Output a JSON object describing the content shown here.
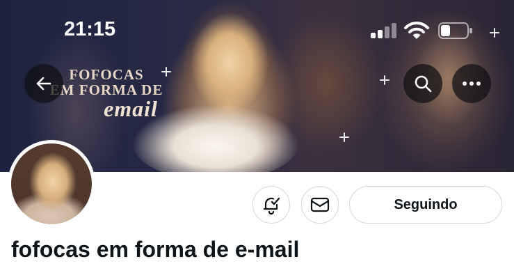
{
  "status_bar": {
    "time": "21:15"
  },
  "banner": {
    "title_line1": "FOFOCAS",
    "title_line2": "EM FORMA DE",
    "title_line3": "email"
  },
  "header_buttons": {
    "back_icon": "arrow-left-icon",
    "search_icon": "search-icon",
    "more_icon": "more-horizontal-icon"
  },
  "actions": {
    "notifications_icon": "bell-plus-icon",
    "message_icon": "envelope-icon",
    "follow_label": "Seguindo"
  },
  "profile": {
    "display_name": "fofocas em forma de e-mail"
  },
  "colors": {
    "text_primary": "#0f1419",
    "button_border": "#cfd9de",
    "banner_dark": "#1c2340"
  }
}
